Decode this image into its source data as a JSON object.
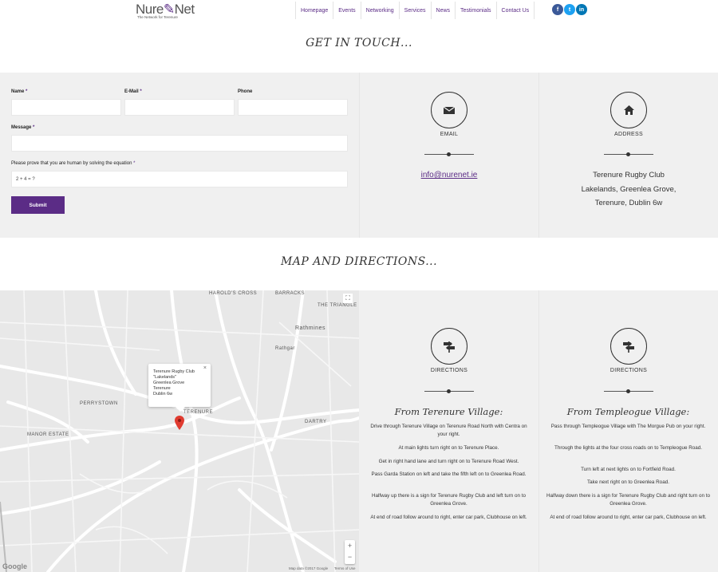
{
  "brand": {
    "name_left": "Nure",
    "name_right": "Net",
    "tagline": "The Network for Terenure",
    "purple": "#5b2c86"
  },
  "nav": [
    "Homepage",
    "Events",
    "Networking",
    "Services",
    "News",
    "Testimonials",
    "Contact Us"
  ],
  "socials": [
    {
      "name": "facebook-icon",
      "glyph": "f"
    },
    {
      "name": "twitter-icon",
      "glyph": "t"
    },
    {
      "name": "linkedin-icon",
      "glyph": "in"
    }
  ],
  "contact": {
    "title": "GET IN TOUCH...",
    "form": {
      "name_label": "Name",
      "email_label": "E-Mail",
      "phone_label": "Phone",
      "message_label": "Message",
      "captcha_label": "Please prove that you are human by solving the equation",
      "required_mark": "*",
      "captcha_value": "2 + 4 = ?",
      "submit_label": "Submit"
    },
    "email_caption": "EMAIL",
    "email_address": "info@nurenet.ie",
    "address_caption": "ADDRESS",
    "address_lines": [
      "Terenure Rugby Club",
      "Lakelands, Greenlea Grove,",
      "Terenure, Dublin 6w"
    ]
  },
  "map_section": {
    "title": "MAP AND DIRECTIONS...",
    "map": {
      "area_labels": [
        "HAROLD'S CROSS",
        "BARRACKS",
        "THE TRIANGLE",
        "Rathmines",
        "Rathgar",
        "PERRYSTOWN",
        "TERENURE",
        "MANOR ESTATE",
        "DARTRY"
      ],
      "popup_lines": [
        "Terenure Rugby Club",
        "\"Lakelands\"",
        "Greenlea Grove",
        "Terenure",
        "Dublin 6w"
      ],
      "attribution": "Map data ©2017 Google",
      "terms": "Terms of Use",
      "google": "Google"
    },
    "directions_caption": "DIRECTIONS",
    "routes": [
      {
        "heading": "From Terenure Village:",
        "steps": [
          "Drive through Terenure Village on Terenure Road North with Centra on your right.",
          "At main lights turn right on to Terenure Place.",
          "Get in right hand lane and turn right on to Terenure Road West.",
          "Pass Garda Station on left and take the fifth left on to Greenlea Road.",
          "Halfway up there is a sign for Terenure Rugby Club and left turn on to Greenlea Grove.",
          "At end of road follow around to right, enter car park, Clubhouse on left."
        ]
      },
      {
        "heading": "From Templeogue Village:",
        "steps": [
          "Pass through Templeogue Village with The Morgue Pub on your right.",
          "Through the lights at the four cross roads on to Templeogue Road.",
          "Turn left at next lights on to Fortfield Road.",
          "Take next right on to Greenlea Road.",
          "Halfway down there is a sign for Terenure Rugby Club and right turn on to Greenlea Grove.",
          "At end of road follow around to right, enter car park, Clubhouse on left."
        ]
      }
    ]
  }
}
